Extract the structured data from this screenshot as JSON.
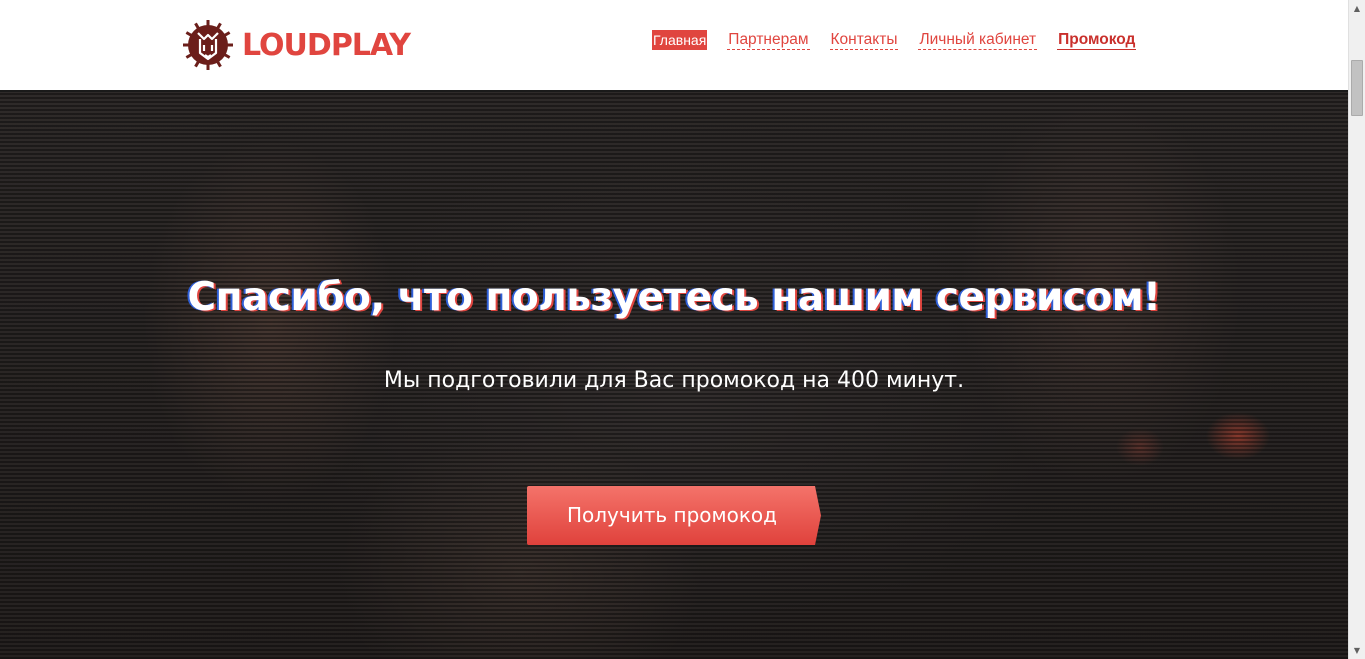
{
  "header": {
    "logo_text": "LOUDPLAY",
    "logo_icon": "lion-icon",
    "nav": [
      {
        "label": "Главная",
        "active": true
      },
      {
        "label": "Партнерам"
      },
      {
        "label": "Контакты"
      },
      {
        "label": "Личный кабинет"
      },
      {
        "label": "Промокод",
        "bold": true
      }
    ]
  },
  "hero": {
    "title": "Спасибо, что пользуетесь нашим сервисом!",
    "subtitle": "Мы подготовили для Вас промокод на 400 минут.",
    "cta_label": "Получить промокод"
  },
  "colors": {
    "accent": "#e0453f",
    "hero_bg": "#2a2625",
    "button_top": "#f36b63",
    "button_bottom": "#e2443f"
  }
}
